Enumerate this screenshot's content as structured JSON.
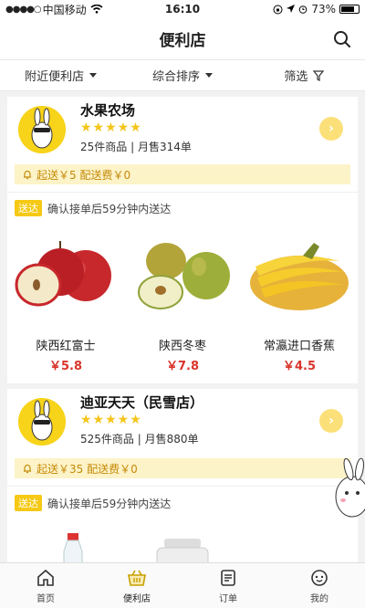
{
  "status_bar": {
    "carrier": "中国移动",
    "time": "16:10",
    "battery": "73%"
  },
  "navbar": {
    "title": "便利店"
  },
  "filters": [
    {
      "label": "附近便利店",
      "icon": "caret-down-icon"
    },
    {
      "label": "综合排序",
      "icon": "caret-down-icon"
    },
    {
      "label": "筛选",
      "icon": "filter-icon"
    }
  ],
  "shops": [
    {
      "name": "水果农场",
      "stars": "★★★★★",
      "meta": "25件商品 | 月售314单",
      "delivery": "起送￥5 配送费￥0",
      "tag": "送达",
      "eta": "确认接单后59分钟内送达",
      "products": [
        {
          "name": "陕西红富士",
          "price": "￥5.8"
        },
        {
          "name": "陕西冬枣",
          "price": "￥7.8"
        },
        {
          "name": "常瀛进口香蕉",
          "price": "￥4.5"
        }
      ]
    },
    {
      "name": "迪亚天天（民雪店）",
      "stars": "★★★★★",
      "meta": "525件商品 | 月售880单",
      "delivery": "起送￥35 配送费￥0",
      "tag": "送达",
      "eta": "确认接单后59分钟内送达"
    }
  ],
  "tabs": [
    {
      "label": "首页",
      "icon": "home-icon"
    },
    {
      "label": "便利店",
      "icon": "basket-icon"
    },
    {
      "label": "订单",
      "icon": "order-icon"
    },
    {
      "label": "我的",
      "icon": "profile-icon"
    }
  ],
  "colors": {
    "accent": "#f6c914",
    "price": "#d9342b",
    "delivery_bg": "#fdf3c8",
    "delivery_text": "#c58a09"
  }
}
